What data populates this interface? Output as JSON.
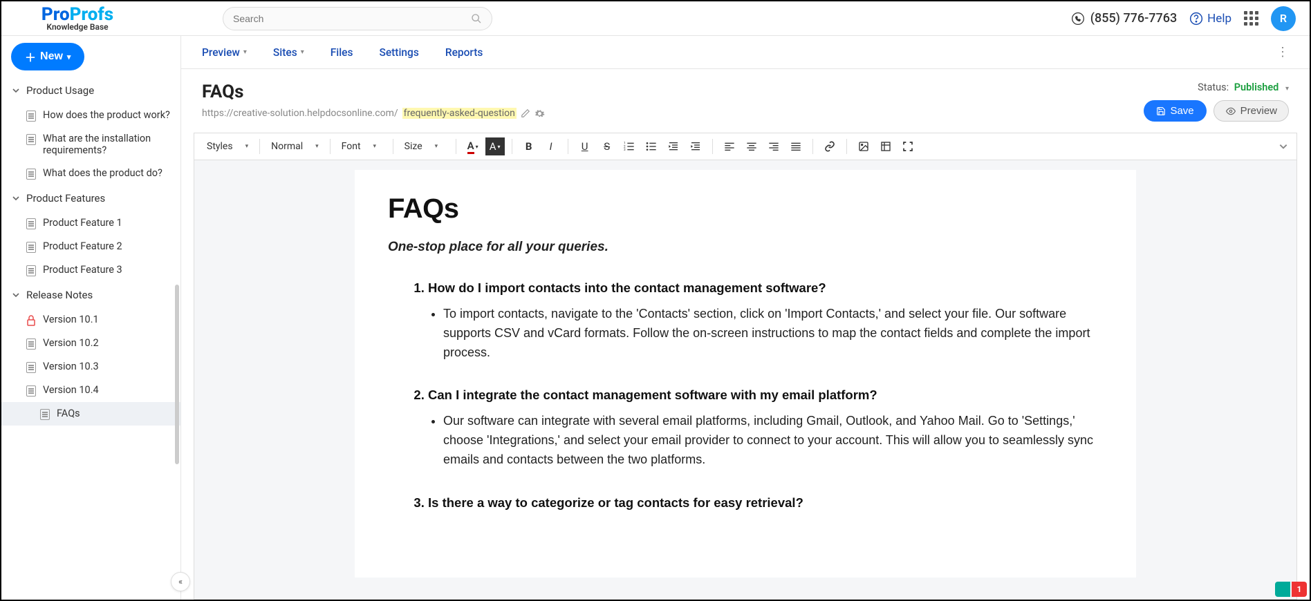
{
  "header": {
    "logo_primary": "Pro",
    "logo_secondary": "Profs",
    "logo_sub": "Knowledge Base",
    "search_placeholder": "Search",
    "phone": "(855) 776-7763",
    "help": "Help",
    "avatar_initial": "R"
  },
  "sidebar": {
    "new_label": "New",
    "categories": [
      {
        "label": "Product Usage",
        "items": [
          {
            "label": "How does the product work?"
          },
          {
            "label": "What are the installation requirements?"
          },
          {
            "label": "What does the product do?"
          }
        ]
      },
      {
        "label": "Product Features",
        "items": [
          {
            "label": "Product Feature 1"
          },
          {
            "label": "Product Feature 2"
          },
          {
            "label": "Product Feature 3"
          }
        ]
      },
      {
        "label": "Release Notes",
        "items": [
          {
            "label": "Version 10.1",
            "locked": true
          },
          {
            "label": "Version 10.2"
          },
          {
            "label": "Version 10.3"
          },
          {
            "label": "Version 10.4",
            "children": [
              {
                "label": "FAQs",
                "active": true
              }
            ]
          }
        ]
      }
    ]
  },
  "tabs": {
    "preview": "Preview",
    "sites": "Sites",
    "files": "Files",
    "settings": "Settings",
    "reports": "Reports"
  },
  "page": {
    "title": "FAQs",
    "url_base": "https://creative-solution.helpdocsonline.com/",
    "url_slug": "frequently-asked-question",
    "status_label": "Status:",
    "status_value": "Published",
    "save": "Save",
    "preview": "Preview"
  },
  "toolbar": {
    "styles": "Styles",
    "format": "Normal",
    "font": "Font",
    "size": "Size"
  },
  "doc": {
    "h1": "FAQs",
    "subtitle": "One-stop place for all your queries.",
    "faqs": [
      {
        "q": "How do I import contacts into the contact management software?",
        "a": "To import contacts, navigate to the 'Contacts' section, click on 'Import Contacts,' and select your file. Our software supports CSV and vCard formats. Follow the on-screen instructions to map the contact fields and complete the import process."
      },
      {
        "q": "Can I integrate the contact management software with my email platform?",
        "a": "Our software can integrate with several email platforms, including Gmail, Outlook, and Yahoo Mail. Go to 'Settings,' choose 'Integrations,' and select your email provider to connect to your account. This will allow you to seamlessly sync emails and contacts between the two platforms."
      },
      {
        "q": "Is there a way to categorize or tag contacts for easy retrieval?",
        "a": ""
      }
    ]
  },
  "badge_count": "1"
}
